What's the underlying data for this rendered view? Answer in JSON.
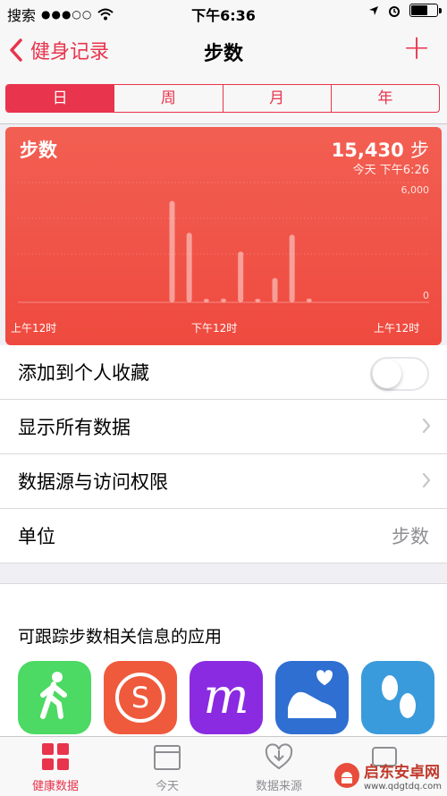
{
  "status_bar": {
    "carrier": "搜索",
    "time": "下午6:36",
    "signal_icon": "signal-dots-icon",
    "wifi_icon": "wifi-icon"
  },
  "nav": {
    "back_label": "健身记录",
    "title": "步数",
    "add_icon": "+"
  },
  "segments": [
    {
      "label": "日",
      "active": true
    },
    {
      "label": "周",
      "active": false
    },
    {
      "label": "月",
      "active": false
    },
    {
      "label": "年",
      "active": false
    }
  ],
  "chart_card": {
    "title": "步数",
    "total_value": "15,430",
    "total_unit": "步",
    "subtitle": "今天 下午6:26",
    "accent_color": "#e8344c"
  },
  "chart_data": {
    "type": "bar",
    "x_labels": [
      "上午12时",
      "下午12时",
      "上午12时"
    ],
    "ylim": [
      0,
      6000
    ],
    "y_tick_labels": [
      "6,000",
      "0"
    ],
    "grid": true,
    "hours": [
      9,
      10,
      11,
      12,
      13,
      14,
      15,
      16,
      17
    ],
    "values": [
      5400,
      3700,
      150,
      200,
      2700,
      150,
      1300,
      3600,
      200
    ]
  },
  "rows": [
    {
      "label": "添加到个人收藏",
      "type": "toggle",
      "on": false
    },
    {
      "label": "显示所有数据",
      "type": "chevron"
    },
    {
      "label": "数据源与访问权限",
      "type": "chevron"
    },
    {
      "label": "单位",
      "type": "value",
      "value": "步数"
    }
  ],
  "apps_section": {
    "header": "可跟踪步数相关信息的应用",
    "apps": [
      {
        "icon": "walking-person-icon",
        "color": "#4cd964"
      },
      {
        "icon": "s-circle-icon",
        "color": "#ef5a3c"
      },
      {
        "icon": "m-letter-icon",
        "color": "#8a2be2"
      },
      {
        "icon": "running-shoe-icon",
        "color": "#2e6fd1"
      },
      {
        "icon": "footprints-icon",
        "color": "#3a9bdc"
      }
    ]
  },
  "tabs": [
    {
      "label": "健康数据",
      "icon": "grid-squares-icon",
      "active": true
    },
    {
      "label": "今天",
      "icon": "calendar-icon",
      "active": false
    },
    {
      "label": "数据来源",
      "icon": "download-heart-icon",
      "active": false
    },
    {
      "label": "",
      "icon": "medical-id-icon",
      "active": false
    }
  ],
  "watermark": {
    "text": "启东安卓网",
    "url": "www.qdgtdq.com"
  }
}
